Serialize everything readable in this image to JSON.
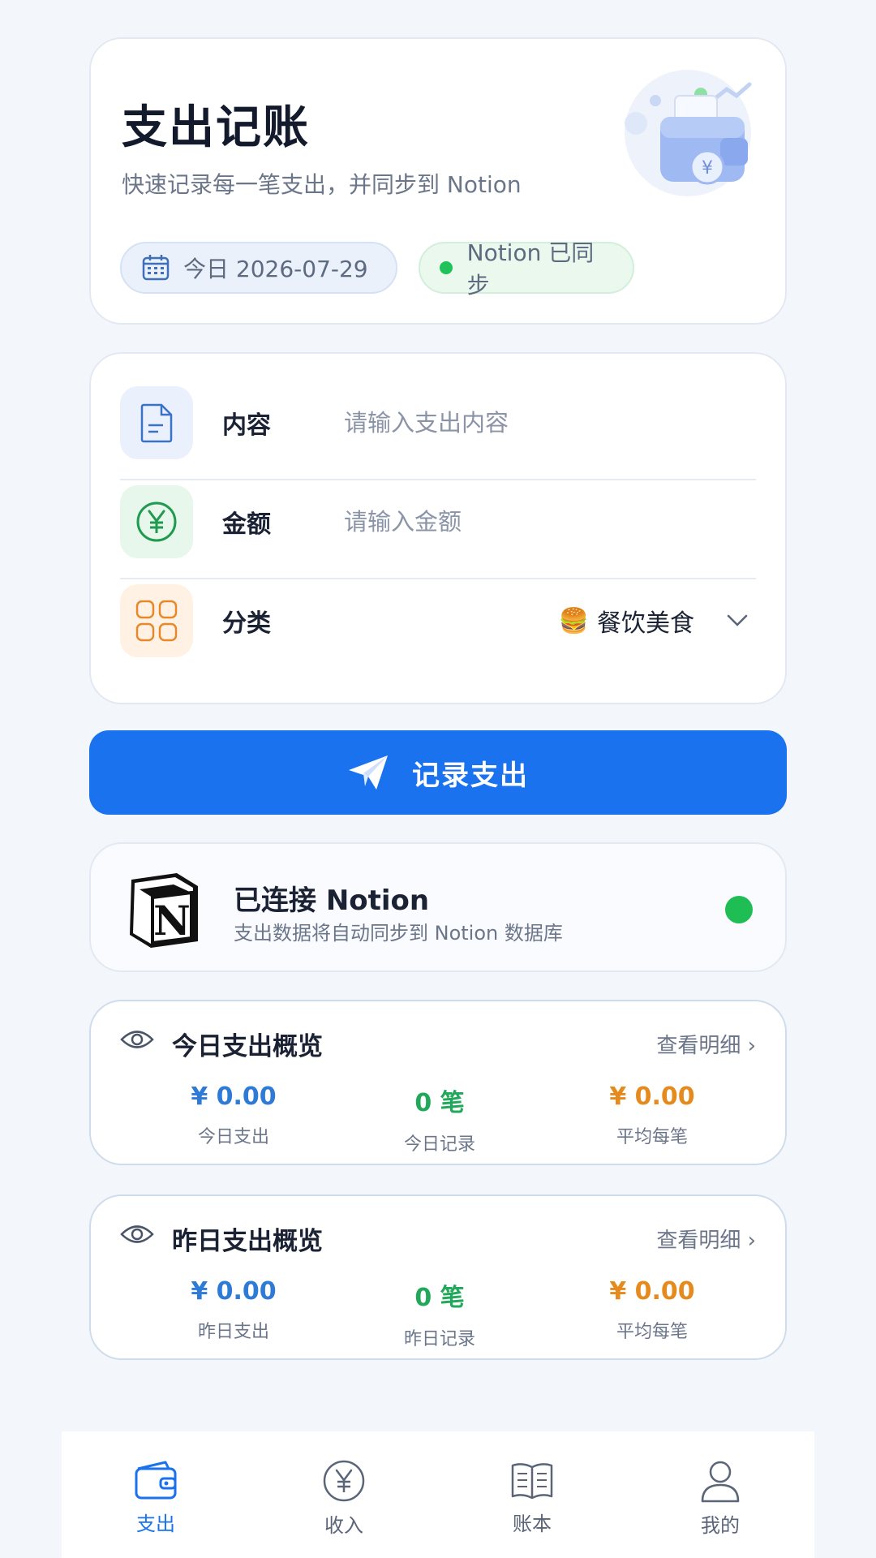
{
  "header": {
    "title": "支出记账",
    "subtitle": "快速记录每一笔支出，并同步到 Notion",
    "date_pill": "今日 2026-07-29",
    "sync_pill": "Notion 已同步"
  },
  "form": {
    "content": {
      "label": "内容",
      "placeholder": "请输入支出内容",
      "value": ""
    },
    "amount": {
      "label": "金额",
      "placeholder": "请输入金额",
      "value": ""
    },
    "category": {
      "label": "分类",
      "emoji": "🍔",
      "value": "餐饮美食"
    }
  },
  "submit_label": "记录支出",
  "notion": {
    "title": "已连接 Notion",
    "subtitle": "支出数据将自动同步到 Notion 数据库",
    "status_color": "#1fbe55"
  },
  "today": {
    "title": "今日支出概览",
    "link": "查看明细 ›",
    "stats": [
      {
        "value": "¥ 0.00",
        "label": "今日支出"
      },
      {
        "value": "0 笔",
        "label": "今日记录"
      },
      {
        "value": "¥ 0.00",
        "label": "平均每笔"
      }
    ]
  },
  "yesterday": {
    "title": "昨日支出概览",
    "link": "查看明细 ›",
    "stats": [
      {
        "value": "¥ 0.00",
        "label": "昨日支出"
      },
      {
        "value": "0 笔",
        "label": "昨日记录"
      },
      {
        "value": "¥ 0.00",
        "label": "平均每笔"
      }
    ]
  },
  "tabs": [
    {
      "label": "支出",
      "icon": "wallet-icon",
      "active": true
    },
    {
      "label": "收入",
      "icon": "yen-circle-icon",
      "active": false
    },
    {
      "label": "账本",
      "icon": "book-icon",
      "active": false
    },
    {
      "label": "我的",
      "icon": "user-icon",
      "active": false
    }
  ],
  "colors": {
    "accent": "#1a72ee",
    "amount_blue": "#2d7bd6",
    "count_green": "#22a85a",
    "avg_orange": "#e58a1c"
  }
}
